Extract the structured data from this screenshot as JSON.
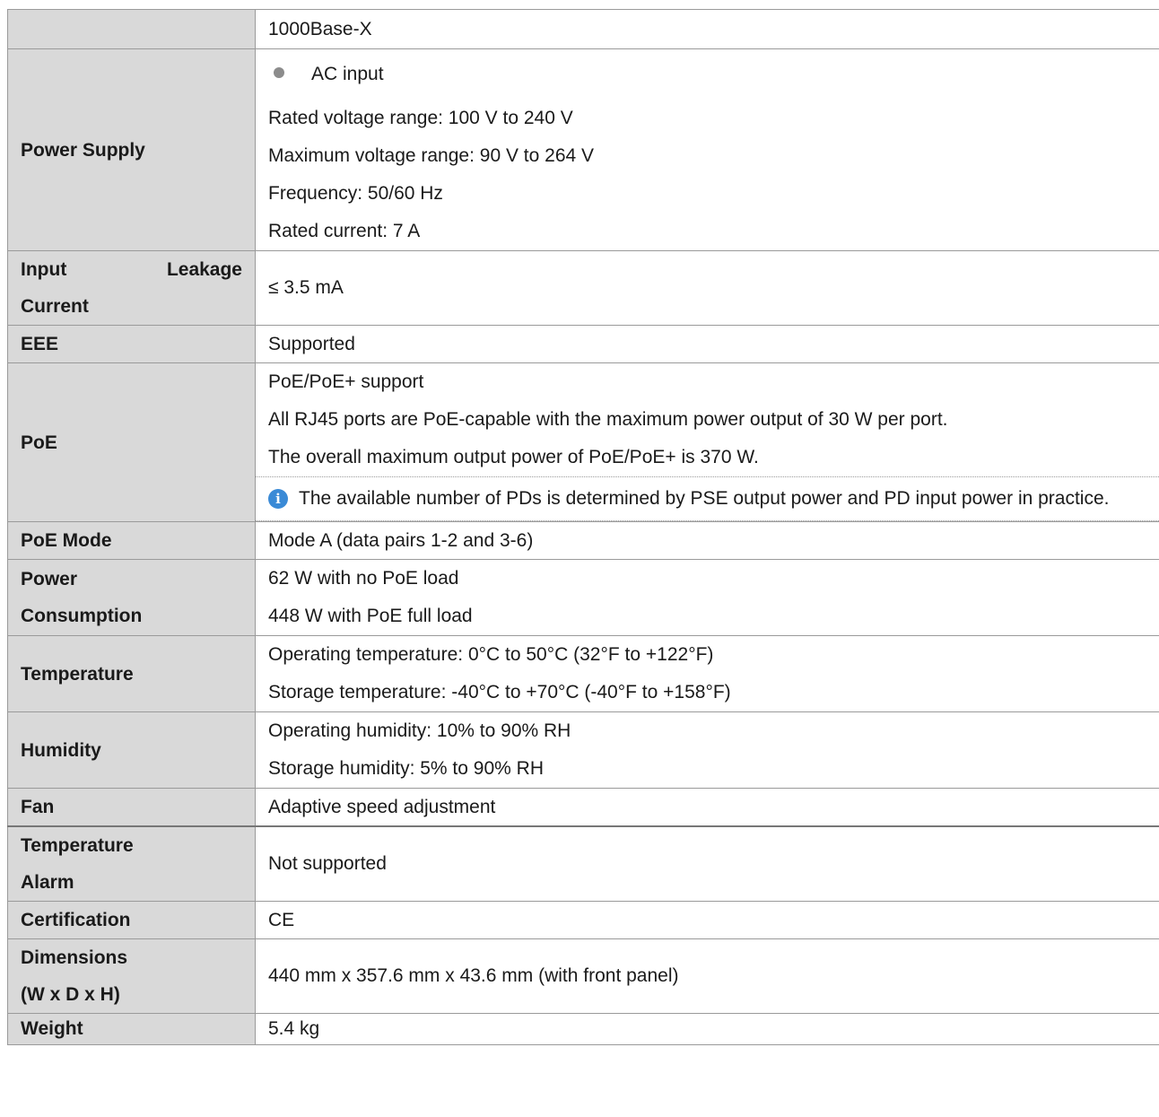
{
  "rows": {
    "port_type": {
      "label": "",
      "value": "1000Base-X"
    },
    "power_supply": {
      "label": "Power Supply",
      "bullet": "AC input",
      "lines": [
        "Rated voltage range: 100 V to 240 V",
        "Maximum voltage range: 90 V to 264 V",
        "Frequency: 50/60 Hz",
        "Rated current: 7 A"
      ]
    },
    "leakage": {
      "label_line1_a": "Input",
      "label_line1_b": "Leakage",
      "label_line2": "Current",
      "value": "≤  3.5 mA"
    },
    "eee": {
      "label": "EEE",
      "value": "Supported"
    },
    "poe": {
      "label": "PoE",
      "lines": [
        "PoE/PoE+ support",
        "All RJ45 ports are PoE-capable with the maximum power output of 30 W per port.",
        "The overall maximum output power of PoE/PoE+ is 370 W."
      ],
      "note": "The available number of PDs is determined by PSE output power and PD input power in practice."
    },
    "poe_mode": {
      "label": "PoE Mode",
      "value": "Mode A (data pairs 1-2 and 3-6)"
    },
    "power_consumption": {
      "label_line1": "Power",
      "label_line2": "Consumption",
      "lines": [
        "62 W with no PoE load",
        "448 W with PoE full load"
      ]
    },
    "temperature": {
      "label": "Temperature",
      "lines": [
        "Operating temperature: 0°C to 50°C (32°F to +122°F)",
        "Storage temperature: -40°C to +70°C (-40°F to +158°F)"
      ]
    },
    "humidity": {
      "label": "Humidity",
      "lines": [
        "Operating humidity: 10% to 90% RH",
        "Storage humidity: 5% to 90% RH"
      ]
    },
    "fan": {
      "label": "Fan",
      "value": "Adaptive speed adjustment"
    },
    "temperature_alarm": {
      "label_line1": "Temperature",
      "label_line2": "Alarm",
      "value": "Not supported"
    },
    "certification": {
      "label": "Certification",
      "value": "CE"
    },
    "dimensions": {
      "label_line1": "Dimensions",
      "label_line2": "(W x D x H)",
      "value": "440 mm x 357.6 mm x 43.6 mm (with front panel)"
    },
    "weight": {
      "label": "Weight",
      "value": "5.4 kg"
    }
  },
  "icons": {
    "bullet": "bullet-dot",
    "note": "info-icon"
  },
  "colors": {
    "label_bg": "#d9d9d9",
    "info_icon": "#3a8ad6",
    "border": "#9a9a9a"
  }
}
